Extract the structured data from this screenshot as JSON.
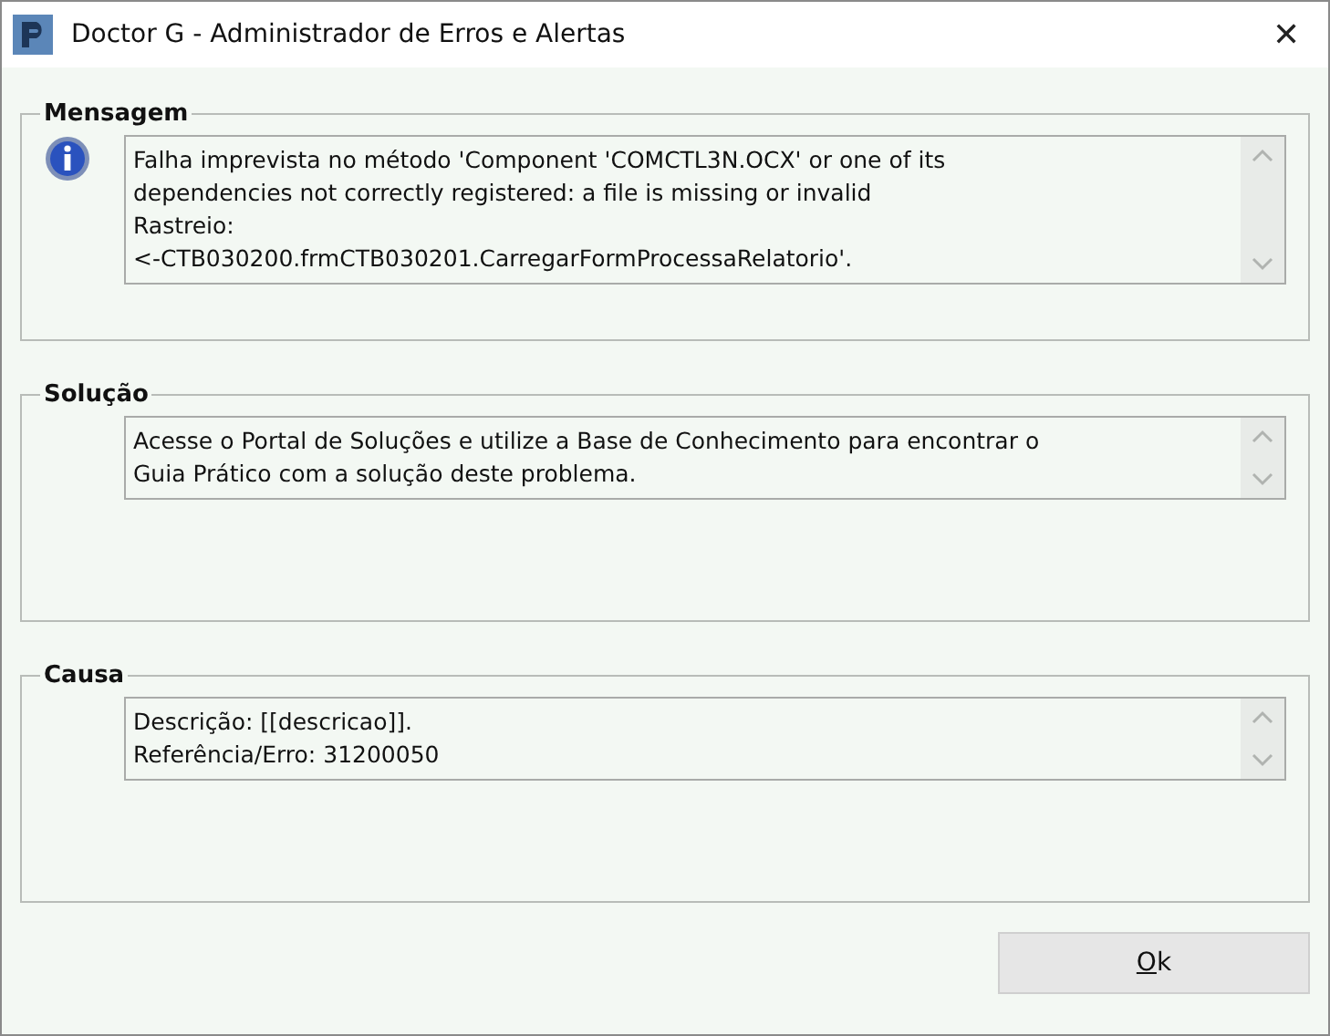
{
  "window": {
    "title": "Doctor G - Administrador de Erros e Alertas",
    "close": "✕"
  },
  "sections": [
    {
      "title": "Mensagem",
      "kind": "info",
      "lines": [
        "Falha imprevista no método 'Component 'COMCTL3N.OCX' or one of its",
        "dependencies not correctly registered: a file is missing or invalid",
        "Rastreio:",
        "<-CTB030200.frmCTB030201.CarregarFormProcessaRelatorio'."
      ]
    },
    {
      "title": "Solução",
      "kind": "plain",
      "lines": [
        "Acesse o Portal de Soluções e utilize a Base de Conhecimento para encontrar o",
        "Guia Prático com a solução deste problema."
      ]
    },
    {
      "title": "Causa",
      "kind": "plain",
      "lines": [
        "Descrição: [[descricao]].",
        "Referência/Erro: 31200050"
      ]
    }
  ],
  "buttons": [
    {
      "label": "Ok"
    }
  ]
}
